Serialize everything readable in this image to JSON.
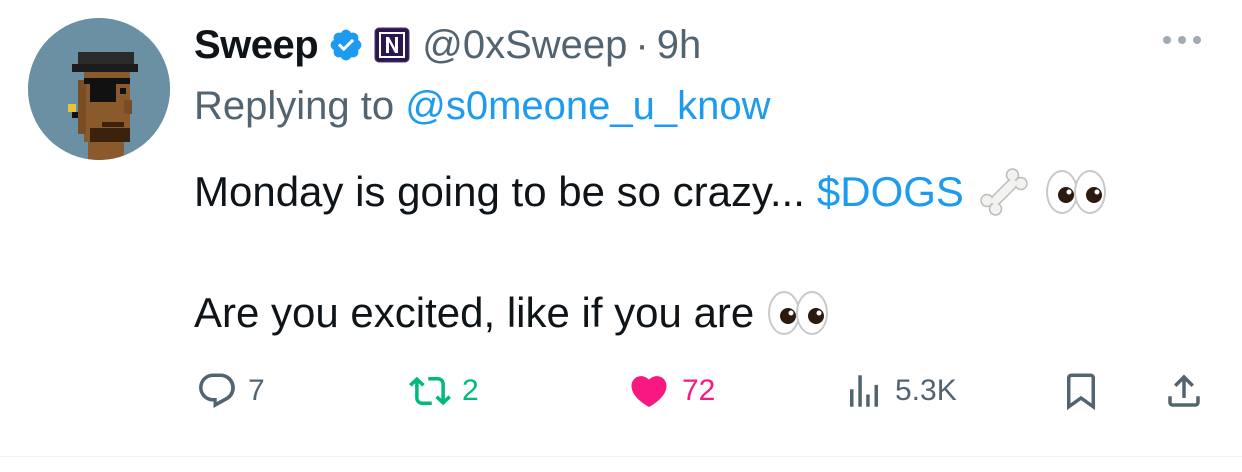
{
  "tweet": {
    "author_name": "Sweep",
    "handle": "@0xSweep",
    "separator": "·",
    "time": "9h",
    "replying_prefix": "Replying to ",
    "replying_to": "@s0meone_u_know",
    "line1_text": "Monday is going to be so crazy...",
    "cashtag": "$DOGS",
    "line2_text": "Are you excited, like if you are"
  },
  "stats": {
    "replies": "7",
    "retweets": "2",
    "likes": "72",
    "views": "5.3K"
  },
  "colors": {
    "link": "#1d9bf0",
    "secondary_text": "#536471",
    "retweet_green": "#00ba7c",
    "like_pink": "#f91880",
    "verified_blue": "#1d9bf0",
    "affiliate_badge": "#2b1650"
  },
  "icons": {
    "verified": "verified-badge-icon",
    "affiliation": "affiliation-badge-icon",
    "more": "more-icon",
    "bone": "bone-emoji",
    "eyes": "eyes-emoji",
    "reply": "reply-icon",
    "retweet": "retweet-icon",
    "like": "heart-icon",
    "views": "views-icon",
    "bookmark": "bookmark-icon",
    "share": "share-icon"
  }
}
